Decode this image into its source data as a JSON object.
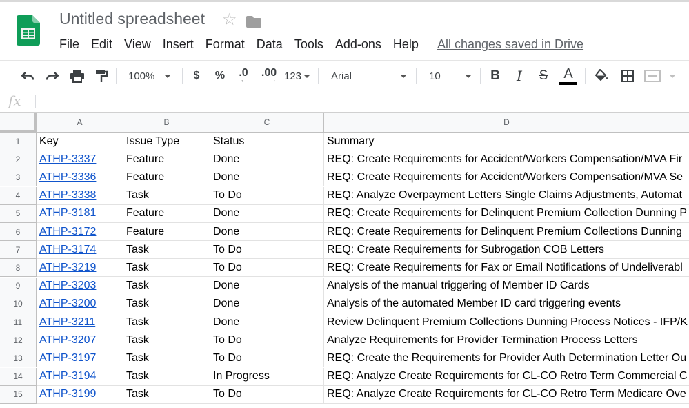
{
  "app": {
    "doc_title": "Untitled spreadsheet",
    "star_icon": "star-icon",
    "folder_icon": "folder-icon"
  },
  "menu": {
    "items": [
      "File",
      "Edit",
      "View",
      "Insert",
      "Format",
      "Data",
      "Tools",
      "Add-ons",
      "Help"
    ],
    "save_status": "All changes saved in Drive"
  },
  "toolbar": {
    "zoom": "100%",
    "currency": "$",
    "percent": "%",
    "decrease_decimal": ".0",
    "increase_decimal": ".00",
    "more_formats": "123",
    "font": "Arial",
    "font_size": "10",
    "bold": "B",
    "italic": "I",
    "strike": "S",
    "text_color": "A"
  },
  "formula_bar": {
    "fx": "fx",
    "value": ""
  },
  "grid": {
    "columns": [
      "A",
      "B",
      "C",
      "D"
    ],
    "rows": [
      {
        "num": "1",
        "a": "Key",
        "b": "Issue Type",
        "c": "Status",
        "d": "Summary"
      },
      {
        "num": "2",
        "a": "ATHP-3337",
        "b": "Feature",
        "c": "Done",
        "d": "REQ: Create Requirements for Accident/Workers Compensation/MVA Fir"
      },
      {
        "num": "3",
        "a": "ATHP-3336",
        "b": "Feature",
        "c": "Done",
        "d": "REQ: Create Requirements for Accident/Workers Compensation/MVA Se"
      },
      {
        "num": "4",
        "a": "ATHP-3338",
        "b": "Task",
        "c": "To Do",
        "d": "REQ: Analyze Overpayment Letters Single Claims Adjustments, Automat"
      },
      {
        "num": "5",
        "a": "ATHP-3181",
        "b": "Feature",
        "c": "Done",
        "d": "REQ: Create Requirements for Delinquent Premium Collection Dunning P"
      },
      {
        "num": "6",
        "a": "ATHP-3172",
        "b": "Feature",
        "c": "Done",
        "d": "REQ: Create Requirements for Delinquent Premium Collections Dunning"
      },
      {
        "num": "7",
        "a": "ATHP-3174",
        "b": "Task",
        "c": "To Do",
        "d": "REQ: Create Requirements for Subrogation COB Letters"
      },
      {
        "num": "8",
        "a": "ATHP-3219",
        "b": "Task",
        "c": "To Do",
        "d": "REQ: Create Requirements for Fax or Email Notifications of Undeliverabl"
      },
      {
        "num": "9",
        "a": "ATHP-3203",
        "b": "Task",
        "c": "Done",
        "d": "Analysis of the manual triggering of Member ID Cards"
      },
      {
        "num": "10",
        "a": "ATHP-3200",
        "b": "Task",
        "c": "Done",
        "d": "Analysis of the automated Member ID card triggering events"
      },
      {
        "num": "11",
        "a": "ATHP-3211",
        "b": "Task",
        "c": "Done",
        "d": "Review Delinquent Premium Collections Dunning Process Notices - IFP/K"
      },
      {
        "num": "12",
        "a": "ATHP-3207",
        "b": "Task",
        "c": "To Do",
        "d": "Analyze Requirements for Provider Termination Process Letters"
      },
      {
        "num": "13",
        "a": "ATHP-3197",
        "b": "Task",
        "c": "To Do",
        "d": "REQ: Create the Requirements for Provider Auth Determination Letter Ou"
      },
      {
        "num": "14",
        "a": "ATHP-3194",
        "b": "Task",
        "c": "In Progress",
        "d": "REQ: Analyze Create Requirements for CL-CO Retro Term Commercial C"
      },
      {
        "num": "15",
        "a": "ATHP-3199",
        "b": "Task",
        "c": "To Do",
        "d": "REQ: Analyze Create Requirements for CL-CO Retro Term Medicare Ove"
      }
    ]
  },
  "colors": {
    "sheets_green": "#0f9d58",
    "link_blue": "#1155cc",
    "header_bg": "#f8f9fa"
  }
}
